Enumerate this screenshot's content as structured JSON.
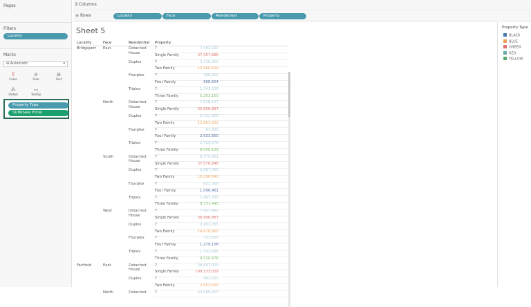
{
  "left_panel": {
    "pages_label": "Pages",
    "filters_label": "Filters",
    "filter_pill": "Locality",
    "marks_label": "Marks",
    "marks_type": "Automatic",
    "mark_buttons": [
      "Color",
      "Size",
      "Text",
      "Detail",
      "Tooltip"
    ],
    "marks_pills": [
      "Property Type",
      "SUM(Sale Price)"
    ]
  },
  "shelves": {
    "columns_label": "Columns",
    "rows_label": "Rows",
    "row_pills": [
      "Locality",
      "Face",
      "Residential",
      "Property"
    ]
  },
  "sheet": {
    "title": "Sheet 5",
    "headers": [
      "Locality",
      "Face",
      "Residential",
      "Property"
    ]
  },
  "table": [
    {
      "locality": "Bridgeport",
      "face": "East",
      "residential": "Detached House",
      "property": "?",
      "value": "7,063,020",
      "color": "#a6cbd8"
    },
    {
      "locality": "",
      "face": "",
      "residential": "",
      "property": "Single Family",
      "value": "37,357,686",
      "color": "#e0736b"
    },
    {
      "locality": "",
      "face": "",
      "residential": "Duplex",
      "property": "?",
      "value": "3,116,650",
      "color": "#a6cbd8"
    },
    {
      "locality": "",
      "face": "",
      "residential": "",
      "property": "Two Family",
      "value": "12,966,629",
      "color": "#f2a863"
    },
    {
      "locality": "",
      "face": "",
      "residential": "Fourplex",
      "property": "?",
      "value": "160,000",
      "color": "#a6cbd8"
    },
    {
      "locality": "",
      "face": "",
      "residential": "",
      "property": "Four Family",
      "value": "668,604",
      "color": "#5a6fa8"
    },
    {
      "locality": "",
      "face": "",
      "residential": "Triplex",
      "property": "?",
      "value": "1,342,500",
      "color": "#a6cbd8"
    },
    {
      "locality": "",
      "face": "",
      "residential": "",
      "property": "Three Family",
      "value": "5,303,150",
      "color": "#7bbf6a"
    },
    {
      "locality": "",
      "face": "North",
      "residential": "Detached House",
      "property": "?",
      "value": "7,518,137",
      "color": "#a6cbd8"
    },
    {
      "locality": "",
      "face": "",
      "residential": "",
      "property": "Single Family",
      "value": "35,806,897",
      "color": "#e0736b"
    },
    {
      "locality": "",
      "face": "",
      "residential": "Duplex",
      "property": "?",
      "value": "2,731,300",
      "color": "#a6cbd8"
    },
    {
      "locality": "",
      "face": "",
      "residential": "",
      "property": "Two Family",
      "value": "12,663,922",
      "color": "#f2a863"
    },
    {
      "locality": "",
      "face": "",
      "residential": "Fourplex",
      "property": "?",
      "value": "81,000",
      "color": "#a6cbd8"
    },
    {
      "locality": "",
      "face": "",
      "residential": "",
      "property": "Four Family",
      "value": "2,633,650",
      "color": "#5a6fa8"
    },
    {
      "locality": "",
      "face": "",
      "residential": "Triplex",
      "property": "?",
      "value": "2,729,676",
      "color": "#a6cbd8"
    },
    {
      "locality": "",
      "face": "",
      "residential": "",
      "property": "Three Family",
      "value": "8,040,129",
      "color": "#7bbf6a"
    },
    {
      "locality": "",
      "face": "South",
      "residential": "Detached House",
      "property": "?",
      "value": "8,370,901",
      "color": "#a6cbd8"
    },
    {
      "locality": "",
      "face": "",
      "residential": "",
      "property": "Single Family",
      "value": "37,576,846",
      "color": "#e0736b"
    },
    {
      "locality": "",
      "face": "",
      "residential": "Duplex",
      "property": "?",
      "value": "2,887,050",
      "color": "#a6cbd8"
    },
    {
      "locality": "",
      "face": "",
      "residential": "",
      "property": "Two Family",
      "value": "15,296,640",
      "color": "#f2a863"
    },
    {
      "locality": "",
      "face": "",
      "residential": "Fourplex",
      "property": "?",
      "value": "931,500",
      "color": "#a6cbd8"
    },
    {
      "locality": "",
      "face": "",
      "residential": "",
      "property": "Four Family",
      "value": "1,096,461",
      "color": "#5a6fa8"
    },
    {
      "locality": "",
      "face": "",
      "residential": "Triplex",
      "property": "?",
      "value": "1,407,700",
      "color": "#a6cbd8"
    },
    {
      "locality": "",
      "face": "",
      "residential": "",
      "property": "Three Family",
      "value": "8,731,445",
      "color": "#7bbf6a"
    },
    {
      "locality": "",
      "face": "West",
      "residential": "Detached House",
      "property": "?",
      "value": "7,807,462",
      "color": "#a6cbd8"
    },
    {
      "locality": "",
      "face": "",
      "residential": "",
      "property": "Single Family",
      "value": "36,906,887",
      "color": "#e0736b"
    },
    {
      "locality": "",
      "face": "",
      "residential": "Duplex",
      "property": "?",
      "value": "2,401,055",
      "color": "#a6cbd8"
    },
    {
      "locality": "",
      "face": "",
      "residential": "",
      "property": "Two Family",
      "value": "14,618,960",
      "color": "#f2a863"
    },
    {
      "locality": "",
      "face": "",
      "residential": "Fourplex",
      "property": "?",
      "value": "323,600",
      "color": "#a6cbd8"
    },
    {
      "locality": "",
      "face": "",
      "residential": "",
      "property": "Four Family",
      "value": "1,279,108",
      "color": "#5a6fa8"
    },
    {
      "locality": "",
      "face": "",
      "residential": "Triplex",
      "property": "?",
      "value": "1,541,065",
      "color": "#a6cbd8"
    },
    {
      "locality": "",
      "face": "",
      "residential": "",
      "property": "Three Family",
      "value": "9,520,476",
      "color": "#7bbf6a"
    },
    {
      "locality": "Fairfield",
      "face": "East",
      "residential": "Detached House",
      "property": "?",
      "value": "38,697,000",
      "color": "#a6cbd8"
    },
    {
      "locality": "",
      "face": "",
      "residential": "",
      "property": "Single Family",
      "value": "190,133,029",
      "color": "#e0736b"
    },
    {
      "locality": "",
      "face": "",
      "residential": "Duplex",
      "property": "?",
      "value": "962,500",
      "color": "#a6cbd8"
    },
    {
      "locality": "",
      "face": "",
      "residential": "",
      "property": "Two Family",
      "value": "2,553,000",
      "color": "#f2a863"
    },
    {
      "locality": "",
      "face": "North",
      "residential": "Detached",
      "property": "?",
      "value": "42,569,007",
      "color": "#a6cbd8"
    }
  ],
  "legend": {
    "title": "Property Type",
    "items": [
      {
        "label": "BLACK",
        "color": "#4a7ab0"
      },
      {
        "label": "BLUE",
        "color": "#f0a05a"
      },
      {
        "label": "GREEN",
        "color": "#e0736b"
      },
      {
        "label": "RED",
        "color": "#6aaab0"
      },
      {
        "label": "YELLOW",
        "color": "#5aa96b"
      }
    ]
  },
  "colors": {
    "pill": "#4a9aad",
    "pill_green": "#1a9f6e",
    "shelf_border": "#2a6b58"
  }
}
